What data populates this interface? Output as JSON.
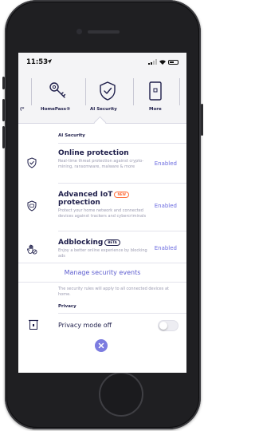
{
  "status_bar": {
    "time": "11:53"
  },
  "tabs": [
    {
      "label": "(*",
      "icon": "partial-icon"
    },
    {
      "label": "HomePass®",
      "icon": "keys-icon"
    },
    {
      "label": "AI Security",
      "icon": "shield-check-icon",
      "active": true
    },
    {
      "label": "More",
      "icon": "phone-device-icon"
    }
  ],
  "section": {
    "title": "AI Security"
  },
  "rows": [
    {
      "title": "Online protection",
      "desc": "Real-time threat protection against crypto-mining, ransomware, malware & more",
      "status": "Enabled",
      "icon": "shield-check-icon"
    },
    {
      "title": "Advanced IoT protection",
      "title_line1": "Advanced IoT",
      "title_line2": "protection",
      "badge": "NEW",
      "desc": "Protect your home network and connected devices against trackers and cybercriminals",
      "status": "Enabled",
      "icon": "shield-iot-icon"
    },
    {
      "title": "Adblocking",
      "badge": "BETA",
      "desc": "Enjoy a better online experience by blocking ads",
      "status": "Enabled",
      "icon": "hand-block-icon"
    }
  ],
  "manage_link": "Manage security events",
  "footnote": "The security rules will apply to all connected devices at home.",
  "privacy": {
    "title": "Privacy",
    "mode_label": "Privacy mode off",
    "enabled": false
  },
  "colors": {
    "accent": "#6c6ce0",
    "navy": "#1e1e4a",
    "muted": "#9a9ab0",
    "badge_new": "#ff6f3c"
  }
}
